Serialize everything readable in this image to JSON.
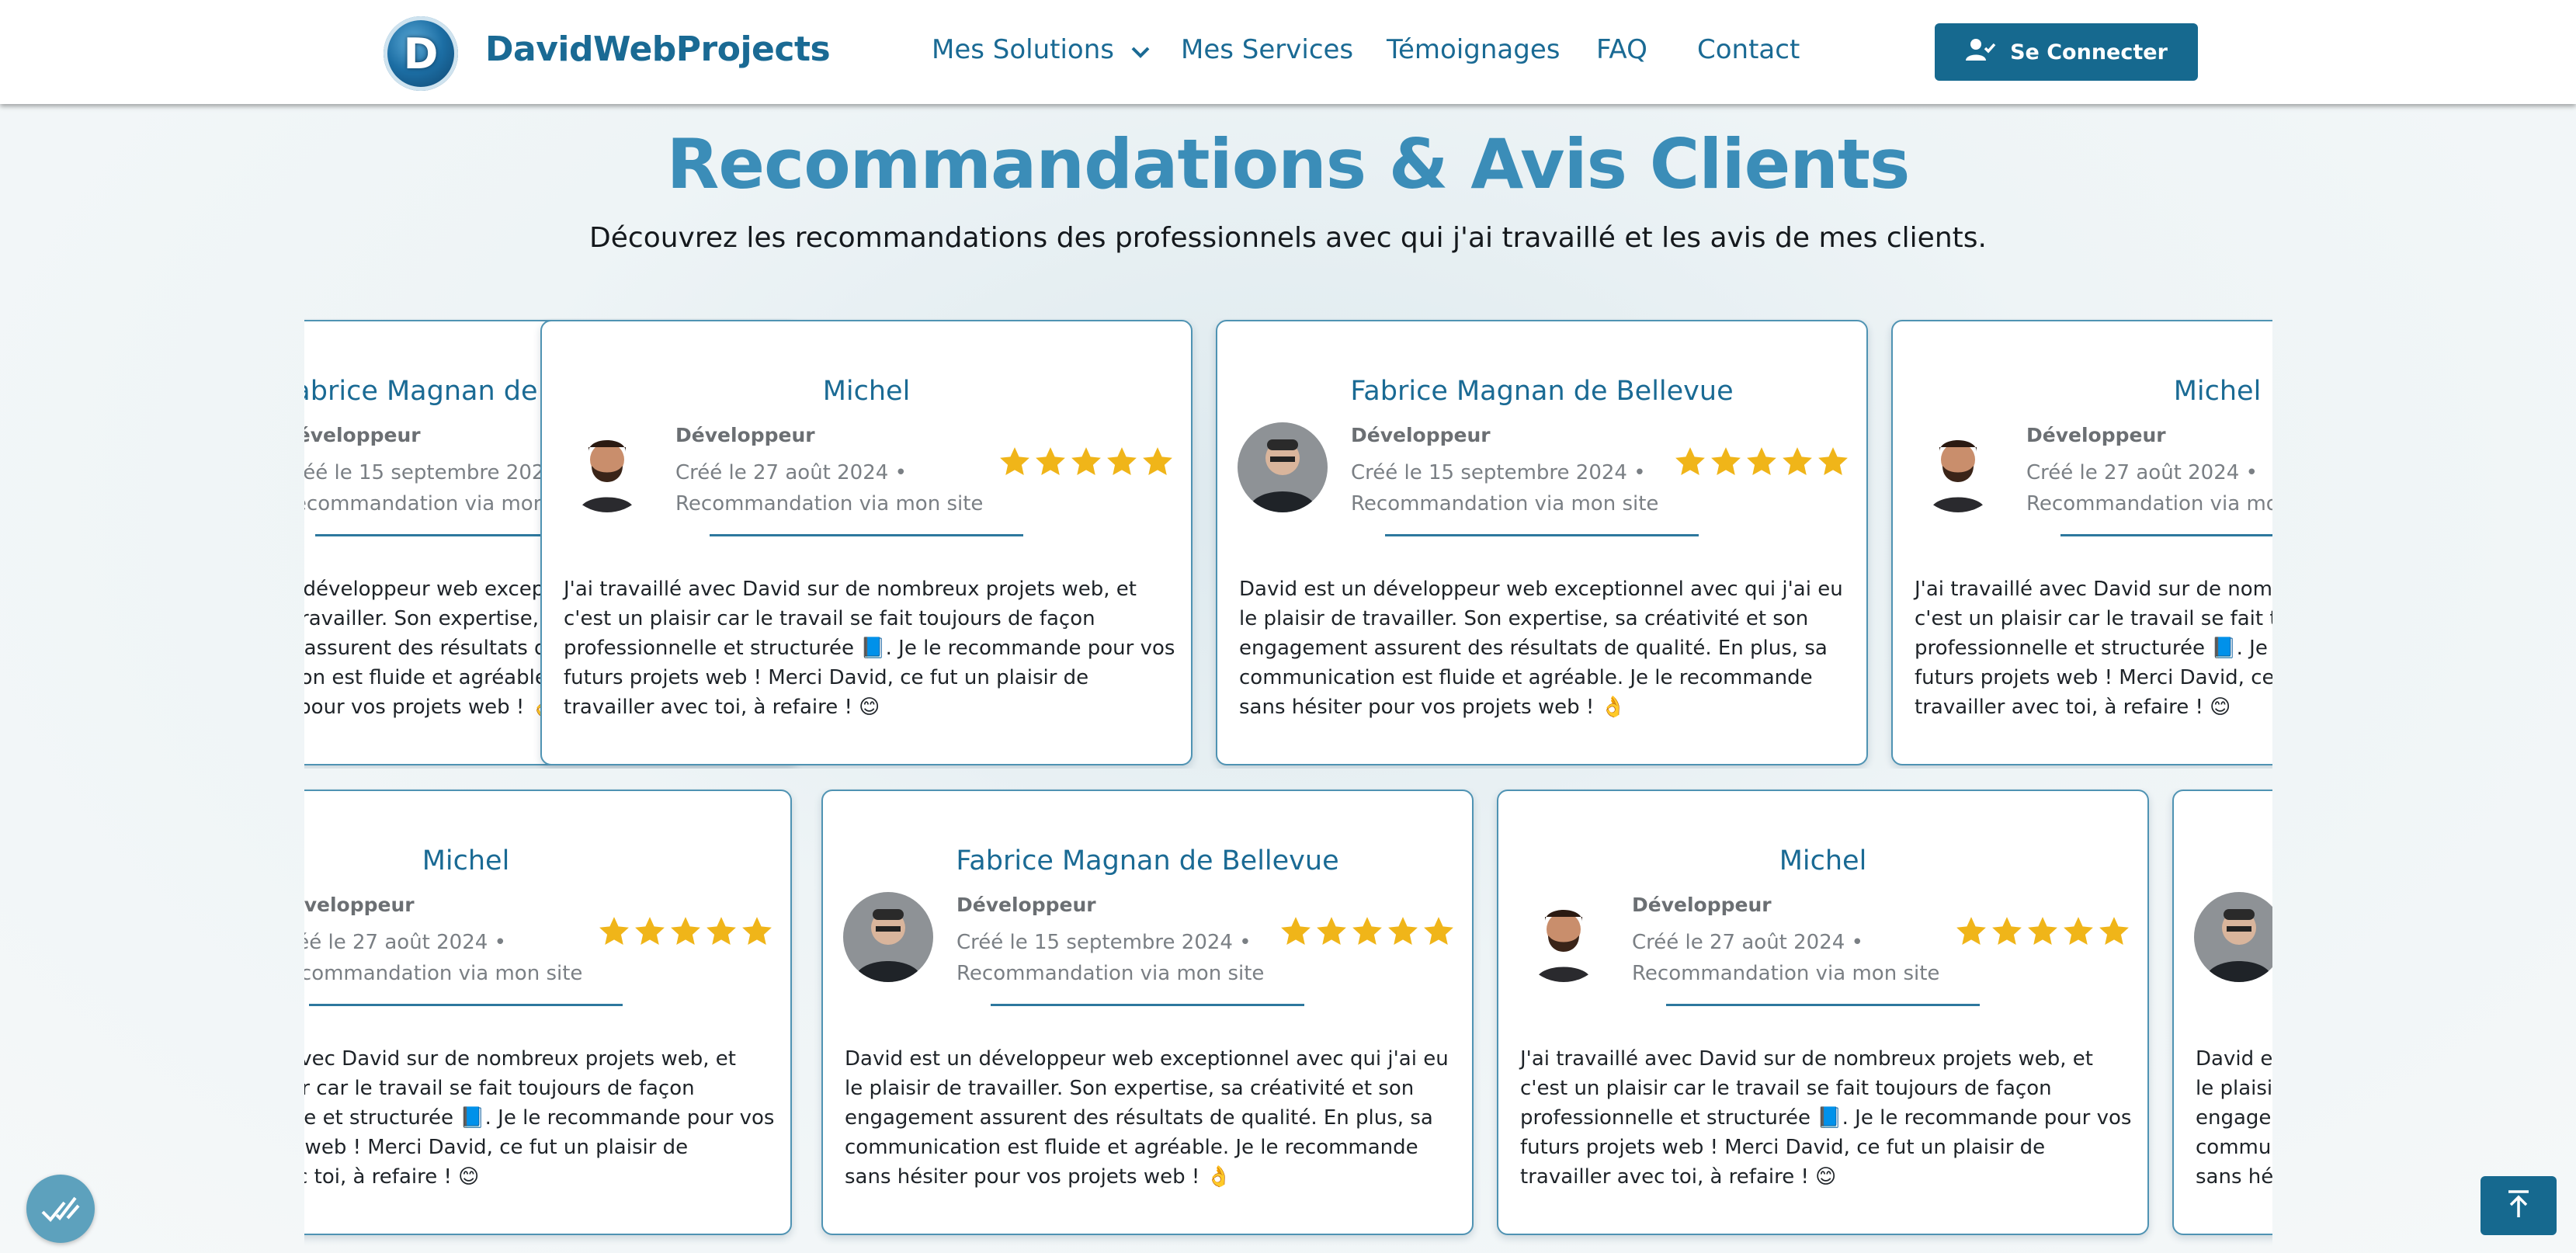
{
  "brand": {
    "logo_letter": "D",
    "name": "DavidWebProjects"
  },
  "nav": {
    "items": [
      "Mes Solutions",
      "Mes Services",
      "Témoignages",
      "FAQ",
      "Contact"
    ],
    "login_label": "Se Connecter"
  },
  "section": {
    "title": "Recommandations & Avis Clients",
    "subtitle": "Découvrez les recommandations des professionnels avec qui j'ai travaillé et les avis de mes clients."
  },
  "testimonials": {
    "michel": {
      "name": "Michel",
      "role": "Développeur",
      "date": "Créé le 27 août 2024 •",
      "source": "Recommandation via mon site",
      "rating": 5,
      "text": "J'ai travaillé avec David sur de nombreux projets web, et c'est un plaisir car le travail se fait toujours de façon professionnelle et structurée 📘. Je le recommande pour vos futurs projets web ! Merci David, ce fut un plaisir de travailler avec toi, à refaire ! 😊"
    },
    "fabrice": {
      "name": "Fabrice Magnan de Bellevue",
      "role": "Développeur",
      "date": "Créé le 15 septembre 2024 •",
      "source": "Recommandation via mon site",
      "rating": 5,
      "text": "David est un développeur web exceptionnel avec qui j'ai eu le plaisir de travailler. Son expertise, sa créativité et son engagement assurent des résultats de qualité. En plus, sa communication est fluide et agréable. Je le recommande sans hésiter pour vos projets web ! 👌"
    }
  },
  "colors": {
    "brand": "#1a6a94",
    "button": "#16698f",
    "star": "#f0b519",
    "title_gradient_start": "#2b7fa9",
    "card_border": "#4f93b3"
  },
  "icons": {
    "login": "user-check-icon",
    "chevron": "chevron-down-icon",
    "accessibility": "accessibility-check-icon",
    "back_to_top": "arrow-up-to-line-icon"
  }
}
